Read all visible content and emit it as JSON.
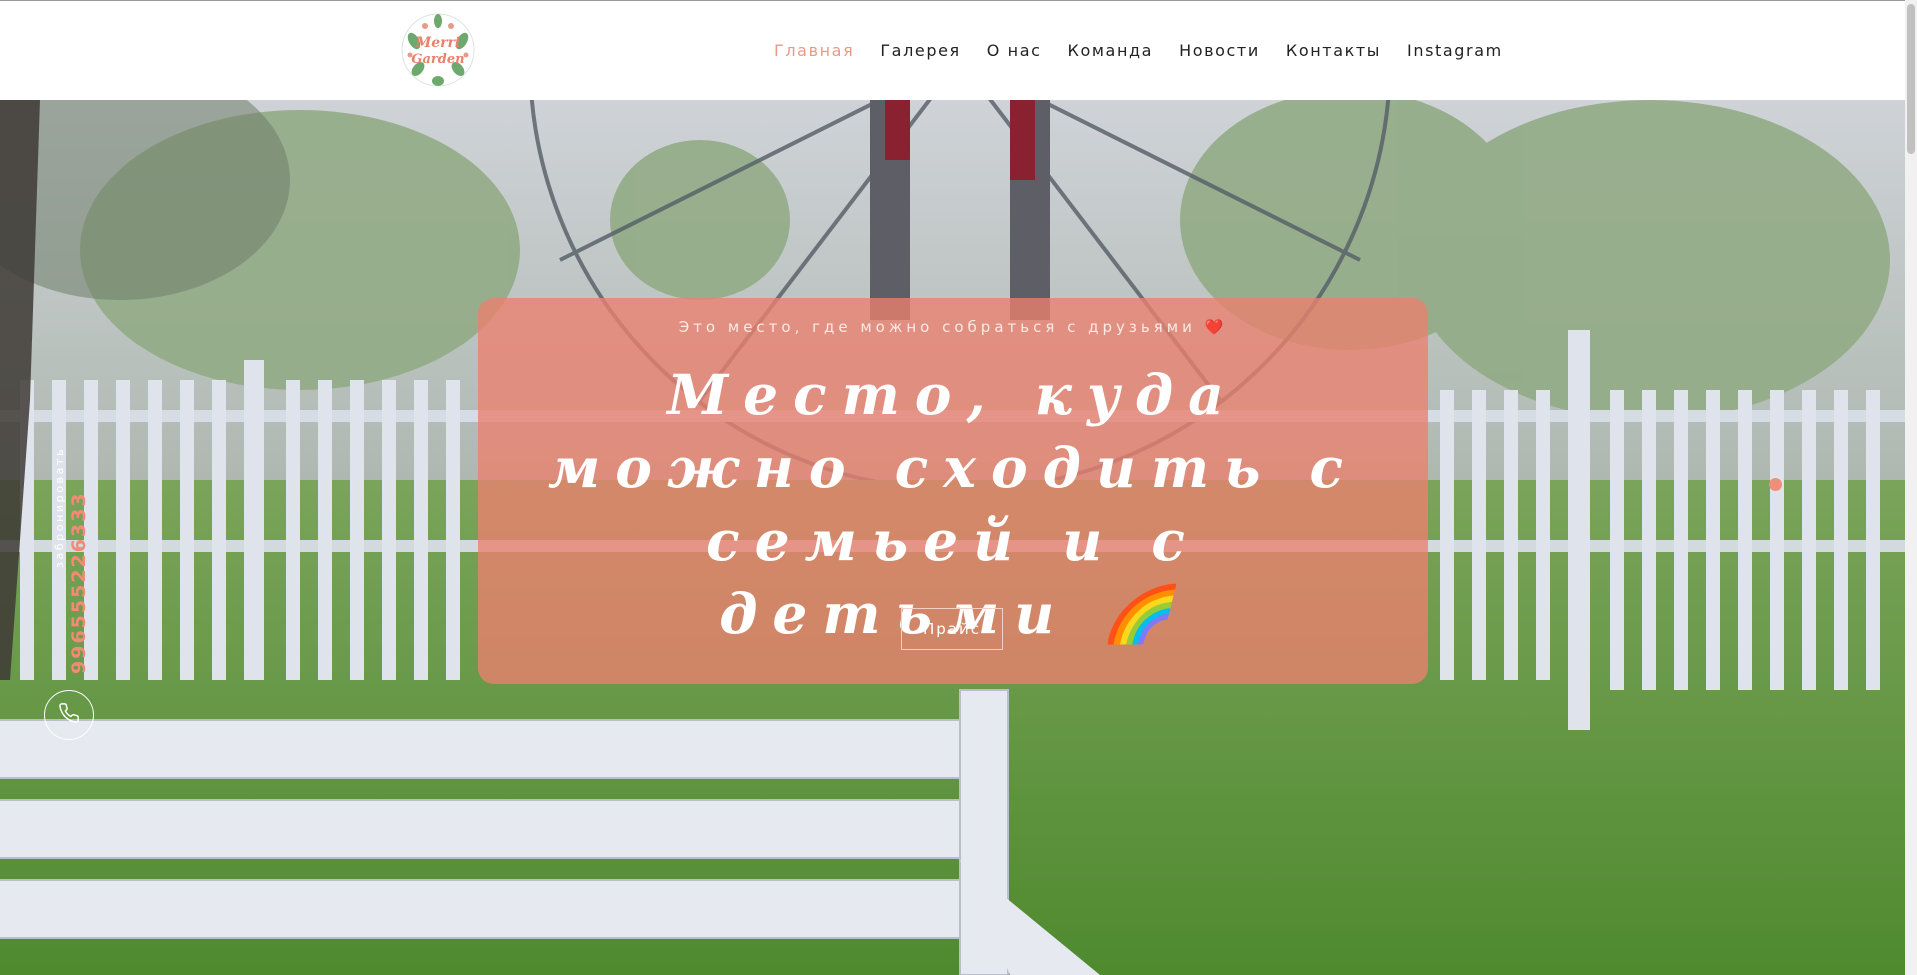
{
  "brand": {
    "logo_text": "Merri Garden"
  },
  "nav": {
    "items": [
      {
        "label": "Главная",
        "active": true
      },
      {
        "label": "Галерея",
        "active": false
      },
      {
        "label": "О нас",
        "active": false
      },
      {
        "label": "Команда",
        "active": false
      },
      {
        "label": "Новости",
        "active": false
      },
      {
        "label": "Контакты",
        "active": false
      },
      {
        "label": "Instagram",
        "active": false
      }
    ]
  },
  "hero": {
    "subtitle": "Это место, где можно собраться с друзьями ❤️",
    "title": "Место, куда можно сходить с семьей и с детьми 🌈",
    "price_button": "Прайс"
  },
  "booking": {
    "label": "забронировать",
    "phone": "996555226333",
    "icon": "phone-icon"
  },
  "colors": {
    "accent": "#e99a87",
    "card": "#ec806e",
    "phone": "#f18a77"
  }
}
